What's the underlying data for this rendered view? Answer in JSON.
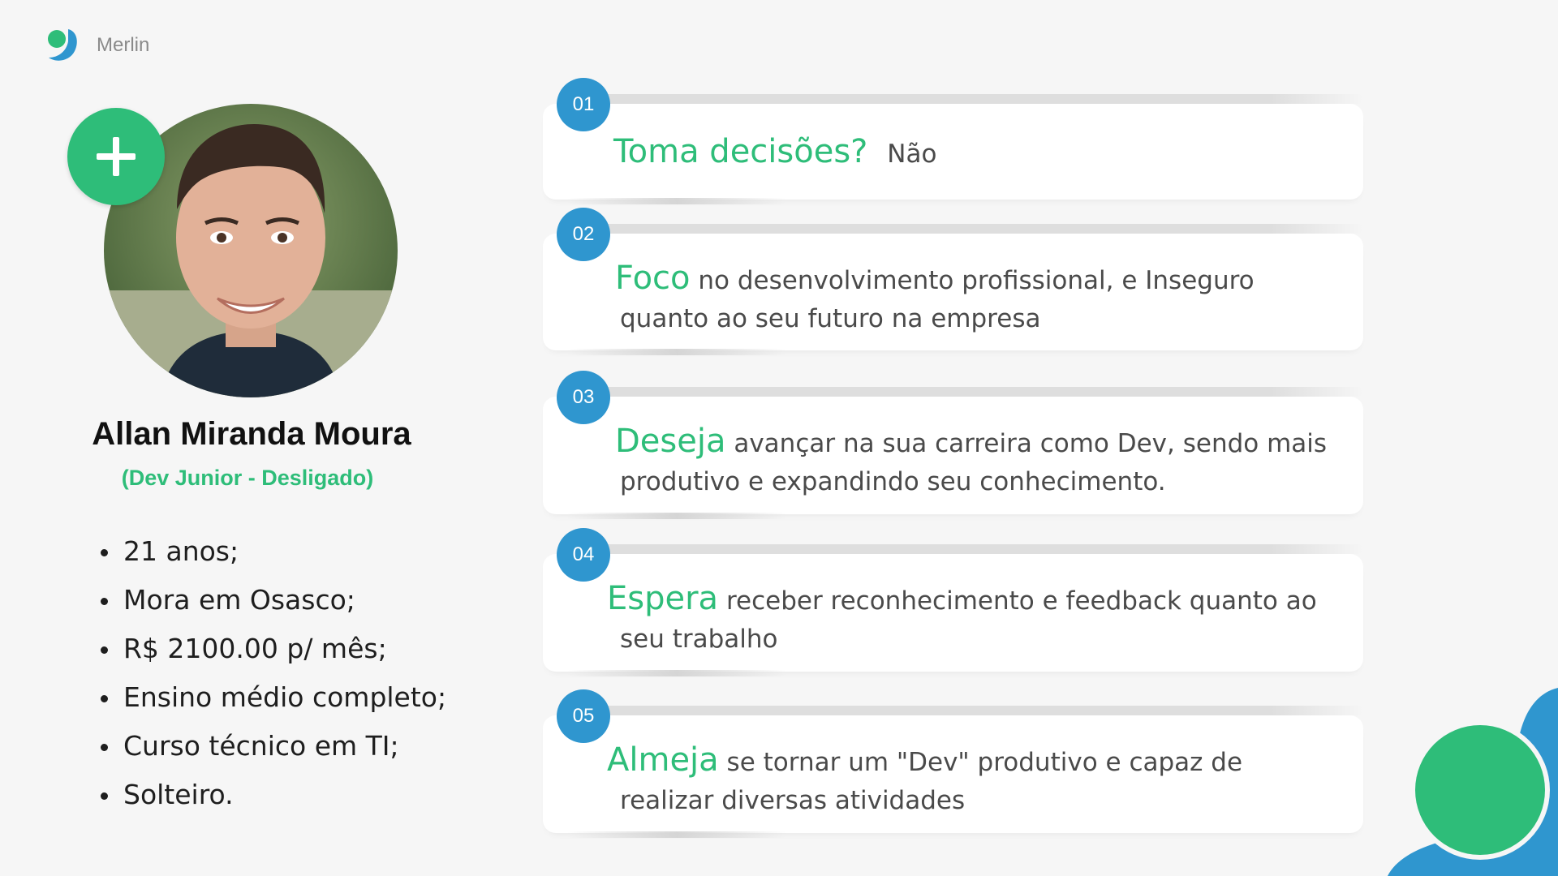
{
  "brand": {
    "name": "Merlin",
    "logo_icon": "merlin-logo-icon"
  },
  "profile": {
    "name": "Allan Miranda Moura",
    "role": "(Dev Junior - Desligado)",
    "photo": "avatar-photo",
    "add_icon": "plus-icon",
    "facts": [
      "21 anos;",
      "Mora em Osasco;",
      "R$ 2100.00 p/ mês;",
      "Ensino médio completo;",
      "Curso técnico em TI;",
      "Solteiro."
    ]
  },
  "cards": [
    {
      "num": "01",
      "keyword": "Toma decisões?",
      "text": "Não"
    },
    {
      "num": "02",
      "keyword": "Foco",
      "text": "no desenvolvimento profissional, e Inseguro quanto ao seu futuro na empresa"
    },
    {
      "num": "03",
      "keyword": "Deseja",
      "text": "avançar na sua carreira como Dev, sendo mais produtivo e expandindo seu conhecimento."
    },
    {
      "num": "04",
      "keyword": "Espera",
      "text": "receber reconhecimento e feedback quanto ao seu trabalho"
    },
    {
      "num": "05",
      "keyword": "Almeja",
      "text": "se tornar um \"Dev\" produtivo e capaz de realizar diversas atividades"
    }
  ],
  "colors": {
    "accent_green": "#2ebd79",
    "accent_blue": "#2f96cf",
    "background": "#f6f6f6"
  }
}
